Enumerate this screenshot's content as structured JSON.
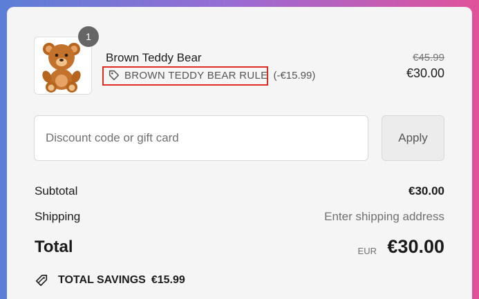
{
  "cart_item": {
    "quantity": "1",
    "name": "Brown Teddy Bear",
    "rule_label": "BROWN TEDDY BEAR RULE",
    "rule_discount": "(-€15.99)",
    "original_price": "€45.99",
    "price": "€30.00",
    "image_icon": "teddy-bear"
  },
  "discount": {
    "placeholder": "Discount code or gift card",
    "value": "",
    "apply_label": "Apply"
  },
  "summary": {
    "subtotal_label": "Subtotal",
    "subtotal_value": "€30.00",
    "shipping_label": "Shipping",
    "shipping_value": "Enter shipping address",
    "total_label": "Total",
    "total_currency": "EUR",
    "total_value": "€30.00",
    "savings_label": "TOTAL SAVINGS",
    "savings_value": "€15.99"
  },
  "colors": {
    "highlight_border": "#e12b20",
    "badge": "#666666",
    "frame_gradient_start": "#5b7fd6",
    "frame_gradient_end": "#e0529a"
  }
}
